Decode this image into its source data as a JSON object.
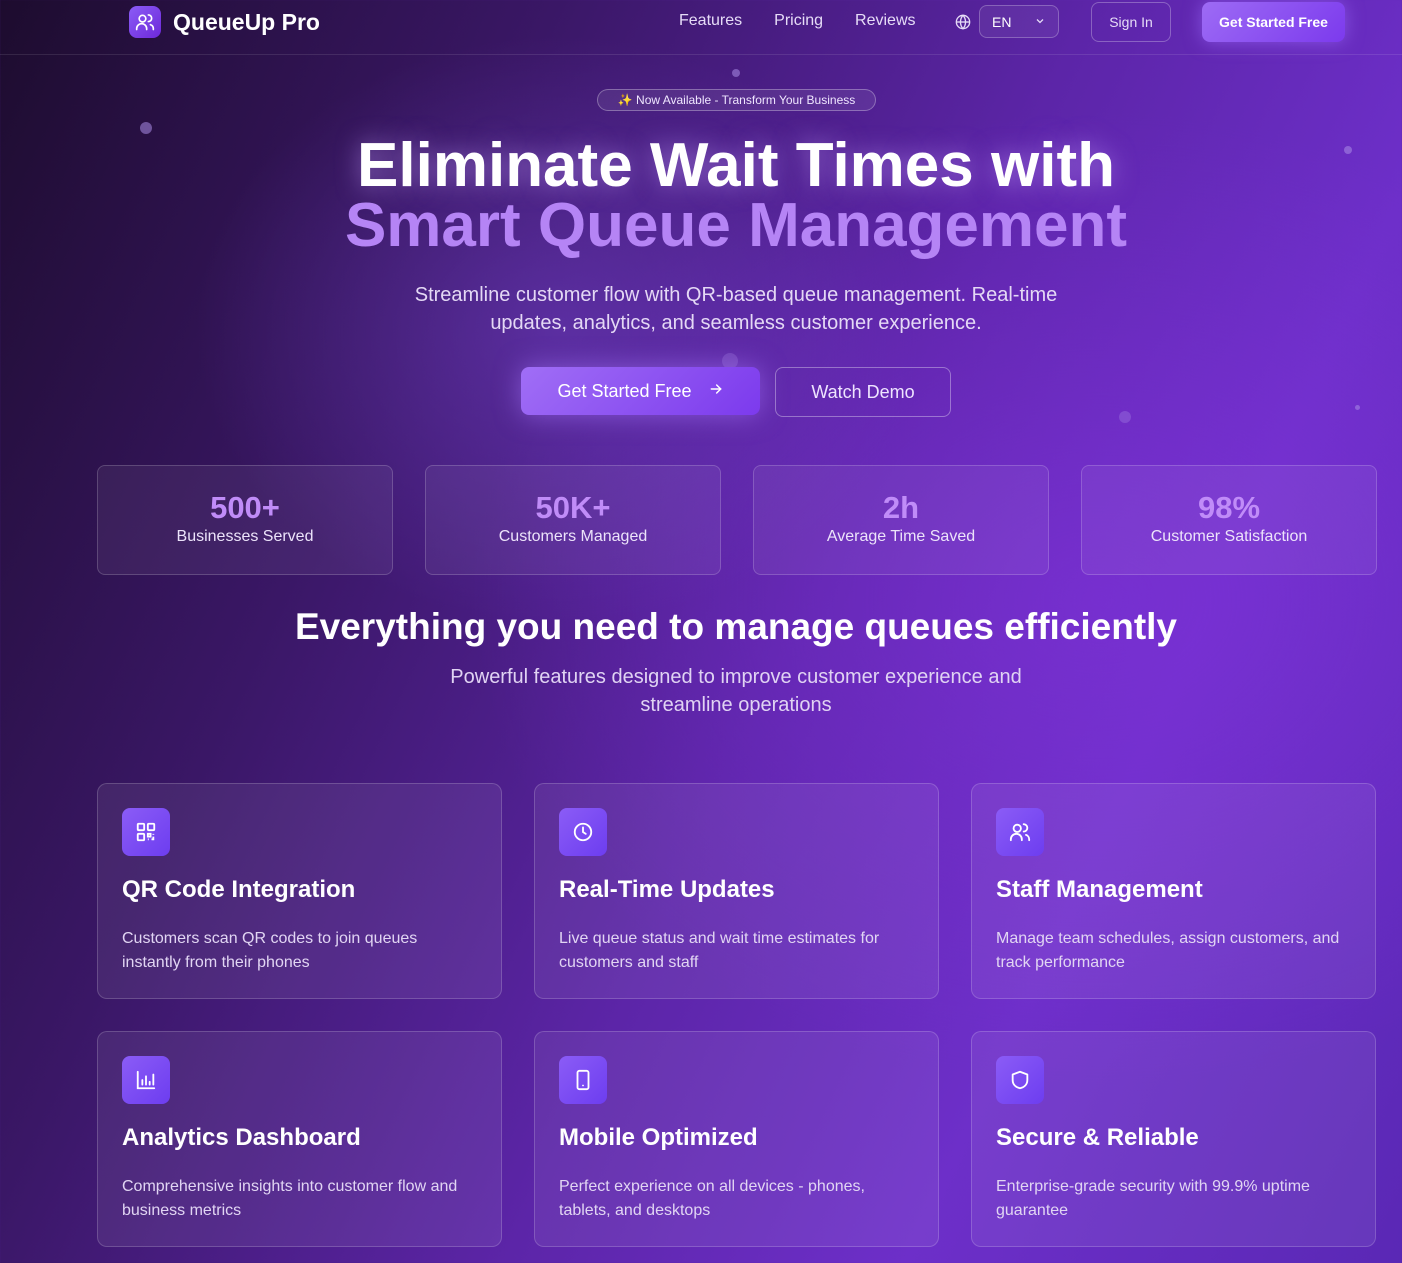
{
  "nav": {
    "brand": "QueueUp Pro",
    "links": [
      "Features",
      "Pricing",
      "Reviews"
    ],
    "language": "EN",
    "sign_in": "Sign In",
    "cta": "Get Started Free"
  },
  "hero": {
    "badge": "✨ Now Available - Transform Your Business",
    "title_line1": "Eliminate Wait Times with",
    "title_line2": "Smart Queue Management",
    "subtitle_line1": "Streamline customer flow with QR-based queue management. Real-time",
    "subtitle_line2": "updates, analytics, and seamless customer experience.",
    "primary_button": "Get Started Free",
    "secondary_button": "Watch Demo"
  },
  "stats": [
    {
      "value": "500+",
      "label": "Businesses Served"
    },
    {
      "value": "50K+",
      "label": "Customers Managed"
    },
    {
      "value": "2h",
      "label": "Average Time Saved"
    },
    {
      "value": "98%",
      "label": "Customer Satisfaction"
    }
  ],
  "features": {
    "title": "Everything you need to manage queues efficiently",
    "subtitle_line1": "Powerful features designed to improve customer experience and",
    "subtitle_line2": "streamline operations",
    "cards": [
      {
        "icon": "qr-code-icon",
        "title": "QR Code Integration",
        "desc": "Customers scan QR codes to join queues instantly from their phones"
      },
      {
        "icon": "clock-icon",
        "title": "Real-Time Updates",
        "desc": "Live queue status and wait time estimates for customers and staff"
      },
      {
        "icon": "users-icon",
        "title": "Staff Management",
        "desc": "Manage team schedules, assign customers, and track performance"
      },
      {
        "icon": "bar-chart-icon",
        "title": "Analytics Dashboard",
        "desc": "Comprehensive insights into customer flow and business metrics"
      },
      {
        "icon": "smartphone-icon",
        "title": "Mobile Optimized",
        "desc": "Perfect experience on all devices - phones, tablets, and desktops"
      },
      {
        "icon": "shield-icon",
        "title": "Secure & Reliable",
        "desc": "Enterprise-grade security with 99.9% uptime guarantee"
      }
    ]
  },
  "colors": {
    "accent": "#8b5cf6",
    "accent_text": "#b584f5",
    "background_dark": "#1d0c2e",
    "background_light": "#6d2fc9"
  }
}
